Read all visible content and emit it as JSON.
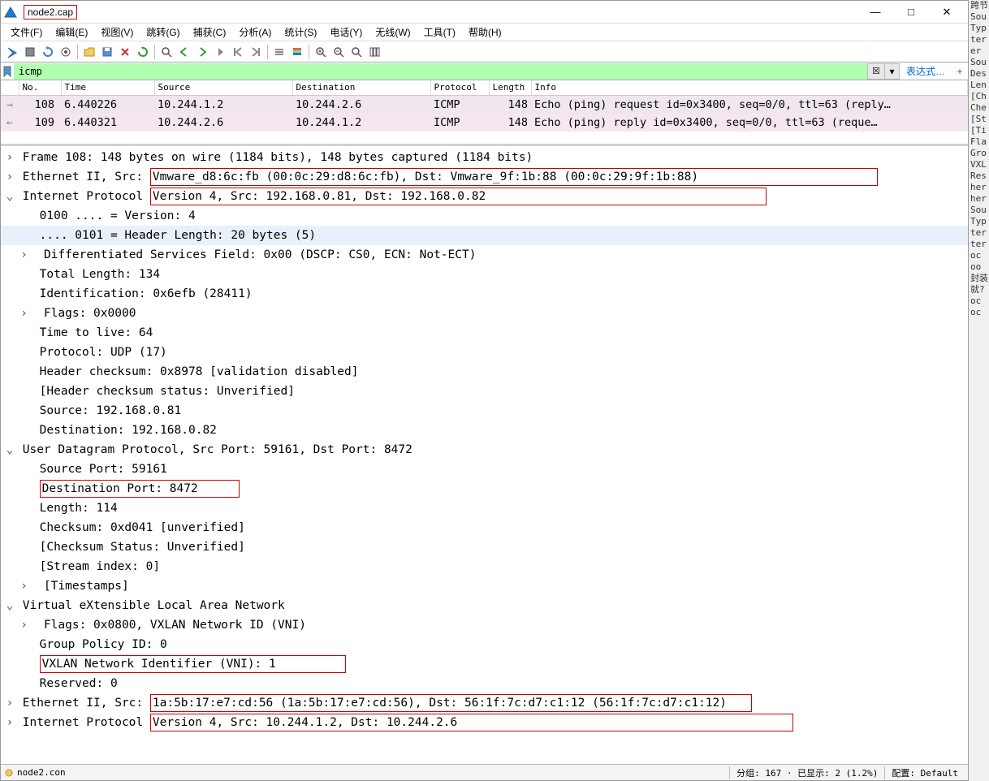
{
  "window": {
    "title": "node2.cap",
    "minimize": "—",
    "maximize": "□",
    "close": "✕"
  },
  "menu": {
    "file": "文件(F)",
    "edit": "编辑(E)",
    "view": "视图(V)",
    "go": "跳转(G)",
    "capture": "捕获(C)",
    "analyze": "分析(A)",
    "statistics": "统计(S)",
    "telephony": "电话(Y)",
    "wireless": "无线(W)",
    "tools": "工具(T)",
    "help": "帮助(H)"
  },
  "filter": {
    "value": "icmp",
    "expr_label": "表达式…",
    "plus": "+"
  },
  "packetlist": {
    "cols": {
      "no": "No.",
      "time": "Time",
      "source": "Source",
      "dest": "Destination",
      "proto": "Protocol",
      "len": "Length",
      "info": "Info"
    },
    "rows": [
      {
        "arrow": "→",
        "no": "108",
        "time": "6.440226",
        "source": "10.244.1.2",
        "dest": "10.244.2.6",
        "proto": "ICMP",
        "len": "148",
        "info": "Echo (ping) request  id=0x3400, seq=0/0, ttl=63 (reply…",
        "class": "req"
      },
      {
        "arrow": "←",
        "no": "109",
        "time": "6.440321",
        "source": "10.244.2.6",
        "dest": "10.244.1.2",
        "proto": "ICMP",
        "len": "148",
        "info": "Echo (ping) reply    id=0x3400, seq=0/0, ttl=63 (reque…",
        "class": "rep"
      }
    ]
  },
  "details": {
    "frame": "Frame 108: 148 bytes on wire (1184 bits), 148 bytes captured (1184 bits)",
    "eth1_prefix": "Ethernet II, Src:",
    "eth1_box": "Vmware_d8:6c:fb (00:0c:29:d8:6c:fb), Dst: Vmware_9f:1b:88 (00:0c:29:9f:1b:88)",
    "ip1_prefix": "Internet Protocol",
    "ip1_box": "Version 4, Src: 192.168.0.81, Dst: 192.168.0.82",
    "ip_children": {
      "version": "0100 .... = Version: 4",
      "hlen": ".... 0101 = Header Length: 20 bytes (5)",
      "dsf": "Differentiated Services Field: 0x00 (DSCP: CS0, ECN: Not-ECT)",
      "totlen": "Total Length: 134",
      "ident": "Identification: 0x6efb (28411)",
      "flags": "Flags: 0x0000",
      "ttl": "Time to live: 64",
      "proto": "Protocol: UDP (17)",
      "hcsum": "Header checksum: 0x8978 [validation disabled]",
      "hcsum_status": "[Header checksum status: Unverified]",
      "src": "Source: 192.168.0.81",
      "dst": "Destination: 192.168.0.82"
    },
    "udp": "User Datagram Protocol, Src Port: 59161, Dst Port: 8472",
    "udp_children": {
      "sport": "Source Port: 59161",
      "dport": "Destination Port: 8472",
      "len": "Length: 114",
      "csum": "Checksum: 0xd041 [unverified]",
      "csum_status": "[Checksum Status: Unverified]",
      "stream": "[Stream index: 0]",
      "timestamps": "[Timestamps]"
    },
    "vxlan": "Virtual eXtensible Local Area Network",
    "vxlan_children": {
      "flags": "Flags: 0x0800, VXLAN Network ID (VNI)",
      "gpid": "Group Policy ID: 0",
      "vni": "VXLAN Network Identifier (VNI): 1",
      "reserved": "Reserved: 0"
    },
    "eth2_prefix": "Ethernet II, Src:",
    "eth2_box": "1a:5b:17:e7:cd:56 (1a:5b:17:e7:cd:56), Dst: 56:1f:7c:d7:c1:12 (56:1f:7c:d7:c1:12)",
    "ip2_prefix": "Internet Protocol",
    "ip2_box": "Version 4, Src: 10.244.1.2, Dst: 10.244.2.6"
  },
  "statusbar": {
    "file": "node2.con",
    "packets": "分组: 167 · 已显示: 2 (1.2%)",
    "profile": "配置: Default"
  },
  "sidebar_fragments": [
    "跨节",
    "Sou",
    "Typ",
    "ter",
    "er",
    "Sou",
    "Des",
    "Len",
    "[Ch",
    "Che",
    "[St",
    "[Ti",
    "Fla",
    "Gro",
    "VXL",
    "Res",
    "her",
    "her",
    "Sou",
    "Typ",
    "ter",
    "ter",
    "",
    "oc",
    "",
    "oo",
    "",
    "封装",
    "就?",
    "",
    "oc",
    "",
    "",
    "oc"
  ]
}
